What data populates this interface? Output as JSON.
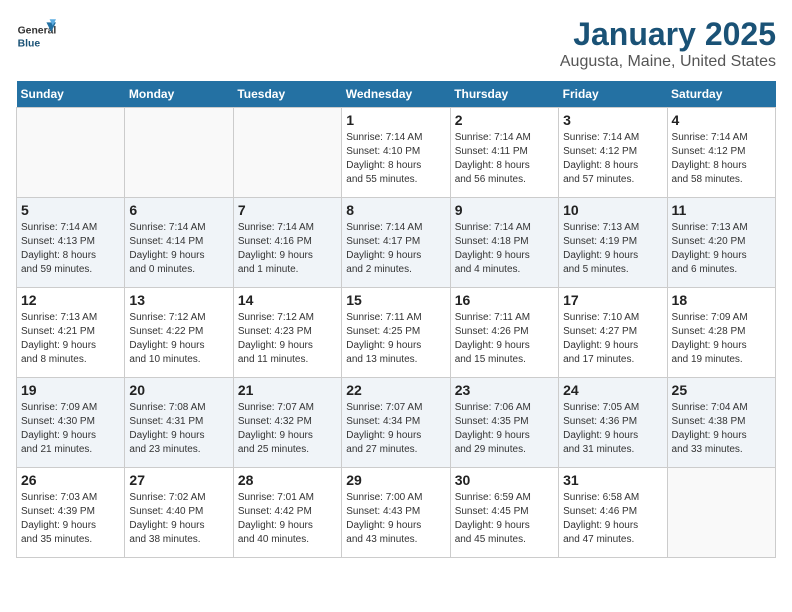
{
  "header": {
    "logo_general": "General",
    "logo_blue": "Blue",
    "title": "January 2025",
    "subtitle": "Augusta, Maine, United States"
  },
  "weekdays": [
    "Sunday",
    "Monday",
    "Tuesday",
    "Wednesday",
    "Thursday",
    "Friday",
    "Saturday"
  ],
  "weeks": [
    {
      "days": [
        {
          "number": "",
          "info": ""
        },
        {
          "number": "",
          "info": ""
        },
        {
          "number": "",
          "info": ""
        },
        {
          "number": "1",
          "info": "Sunrise: 7:14 AM\nSunset: 4:10 PM\nDaylight: 8 hours\nand 55 minutes."
        },
        {
          "number": "2",
          "info": "Sunrise: 7:14 AM\nSunset: 4:11 PM\nDaylight: 8 hours\nand 56 minutes."
        },
        {
          "number": "3",
          "info": "Sunrise: 7:14 AM\nSunset: 4:12 PM\nDaylight: 8 hours\nand 57 minutes."
        },
        {
          "number": "4",
          "info": "Sunrise: 7:14 AM\nSunset: 4:12 PM\nDaylight: 8 hours\nand 58 minutes."
        }
      ]
    },
    {
      "days": [
        {
          "number": "5",
          "info": "Sunrise: 7:14 AM\nSunset: 4:13 PM\nDaylight: 8 hours\nand 59 minutes."
        },
        {
          "number": "6",
          "info": "Sunrise: 7:14 AM\nSunset: 4:14 PM\nDaylight: 9 hours\nand 0 minutes."
        },
        {
          "number": "7",
          "info": "Sunrise: 7:14 AM\nSunset: 4:16 PM\nDaylight: 9 hours\nand 1 minute."
        },
        {
          "number": "8",
          "info": "Sunrise: 7:14 AM\nSunset: 4:17 PM\nDaylight: 9 hours\nand 2 minutes."
        },
        {
          "number": "9",
          "info": "Sunrise: 7:14 AM\nSunset: 4:18 PM\nDaylight: 9 hours\nand 4 minutes."
        },
        {
          "number": "10",
          "info": "Sunrise: 7:13 AM\nSunset: 4:19 PM\nDaylight: 9 hours\nand 5 minutes."
        },
        {
          "number": "11",
          "info": "Sunrise: 7:13 AM\nSunset: 4:20 PM\nDaylight: 9 hours\nand 6 minutes."
        }
      ]
    },
    {
      "days": [
        {
          "number": "12",
          "info": "Sunrise: 7:13 AM\nSunset: 4:21 PM\nDaylight: 9 hours\nand 8 minutes."
        },
        {
          "number": "13",
          "info": "Sunrise: 7:12 AM\nSunset: 4:22 PM\nDaylight: 9 hours\nand 10 minutes."
        },
        {
          "number": "14",
          "info": "Sunrise: 7:12 AM\nSunset: 4:23 PM\nDaylight: 9 hours\nand 11 minutes."
        },
        {
          "number": "15",
          "info": "Sunrise: 7:11 AM\nSunset: 4:25 PM\nDaylight: 9 hours\nand 13 minutes."
        },
        {
          "number": "16",
          "info": "Sunrise: 7:11 AM\nSunset: 4:26 PM\nDaylight: 9 hours\nand 15 minutes."
        },
        {
          "number": "17",
          "info": "Sunrise: 7:10 AM\nSunset: 4:27 PM\nDaylight: 9 hours\nand 17 minutes."
        },
        {
          "number": "18",
          "info": "Sunrise: 7:09 AM\nSunset: 4:28 PM\nDaylight: 9 hours\nand 19 minutes."
        }
      ]
    },
    {
      "days": [
        {
          "number": "19",
          "info": "Sunrise: 7:09 AM\nSunset: 4:30 PM\nDaylight: 9 hours\nand 21 minutes."
        },
        {
          "number": "20",
          "info": "Sunrise: 7:08 AM\nSunset: 4:31 PM\nDaylight: 9 hours\nand 23 minutes."
        },
        {
          "number": "21",
          "info": "Sunrise: 7:07 AM\nSunset: 4:32 PM\nDaylight: 9 hours\nand 25 minutes."
        },
        {
          "number": "22",
          "info": "Sunrise: 7:07 AM\nSunset: 4:34 PM\nDaylight: 9 hours\nand 27 minutes."
        },
        {
          "number": "23",
          "info": "Sunrise: 7:06 AM\nSunset: 4:35 PM\nDaylight: 9 hours\nand 29 minutes."
        },
        {
          "number": "24",
          "info": "Sunrise: 7:05 AM\nSunset: 4:36 PM\nDaylight: 9 hours\nand 31 minutes."
        },
        {
          "number": "25",
          "info": "Sunrise: 7:04 AM\nSunset: 4:38 PM\nDaylight: 9 hours\nand 33 minutes."
        }
      ]
    },
    {
      "days": [
        {
          "number": "26",
          "info": "Sunrise: 7:03 AM\nSunset: 4:39 PM\nDaylight: 9 hours\nand 35 minutes."
        },
        {
          "number": "27",
          "info": "Sunrise: 7:02 AM\nSunset: 4:40 PM\nDaylight: 9 hours\nand 38 minutes."
        },
        {
          "number": "28",
          "info": "Sunrise: 7:01 AM\nSunset: 4:42 PM\nDaylight: 9 hours\nand 40 minutes."
        },
        {
          "number": "29",
          "info": "Sunrise: 7:00 AM\nSunset: 4:43 PM\nDaylight: 9 hours\nand 43 minutes."
        },
        {
          "number": "30",
          "info": "Sunrise: 6:59 AM\nSunset: 4:45 PM\nDaylight: 9 hours\nand 45 minutes."
        },
        {
          "number": "31",
          "info": "Sunrise: 6:58 AM\nSunset: 4:46 PM\nDaylight: 9 hours\nand 47 minutes."
        },
        {
          "number": "",
          "info": ""
        }
      ]
    }
  ]
}
